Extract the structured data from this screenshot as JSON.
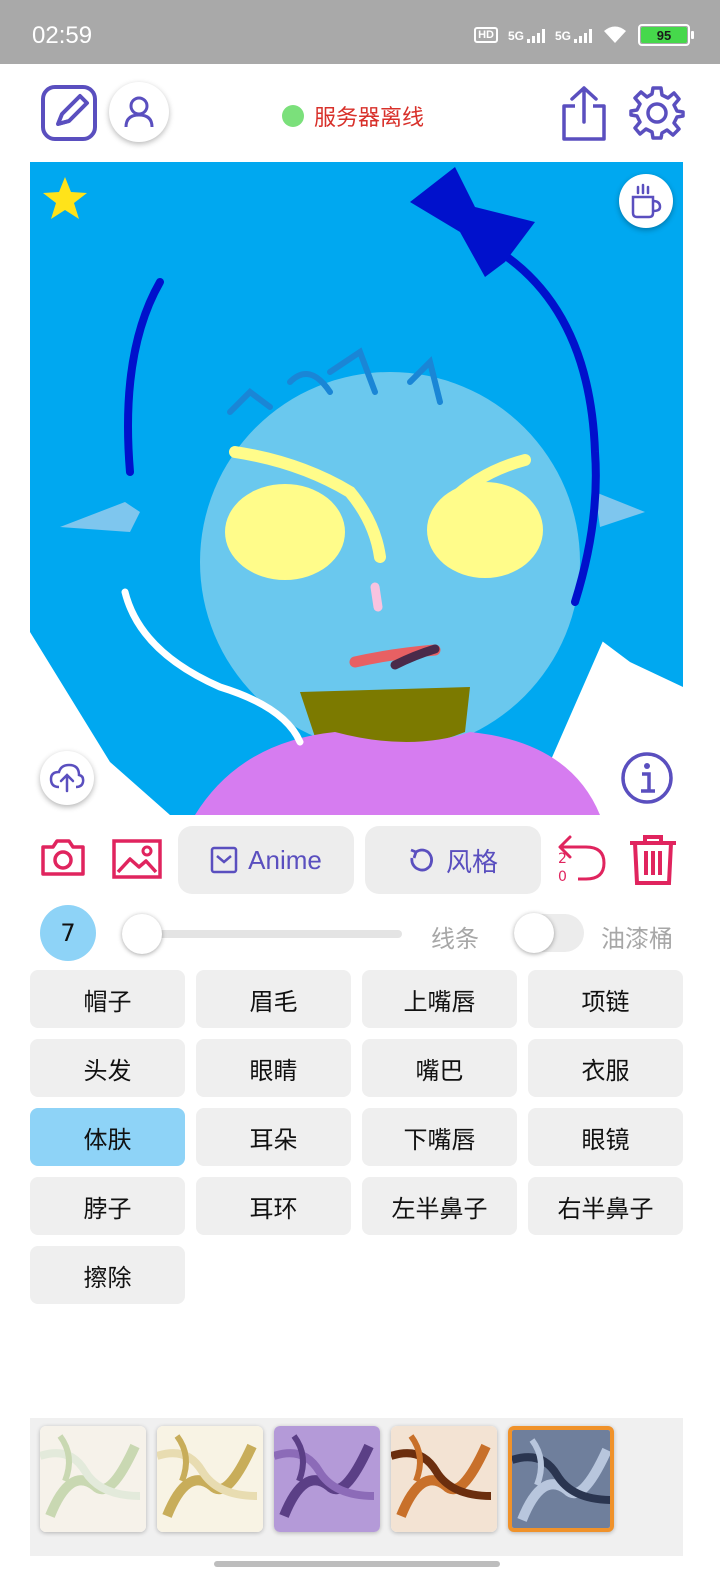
{
  "status_bar": {
    "time": "02:59",
    "battery": "95",
    "network_1": "5G",
    "network_2": "5G",
    "hd_label": "HD"
  },
  "header": {
    "server_status": "服务器离线",
    "server_dot_color": "#7be07b"
  },
  "icons": {
    "edit": "edit-square-icon",
    "profile": "person-icon",
    "share": "share-icon",
    "settings": "gear-icon",
    "favorite": "star-icon",
    "coffee": "coffee-cup-icon",
    "upload": "cloud-upload-icon",
    "info": "info-icon",
    "camera": "camera-icon",
    "gallery": "image-icon",
    "undo": "undo-icon",
    "trash": "trash-icon"
  },
  "actions": {
    "anime_label": "Anime",
    "style_label": "风格",
    "undo_numerator": "2",
    "undo_denominator": "0"
  },
  "brush": {
    "size": "7",
    "size_level": 0.0,
    "line_label": "线条",
    "bucket_label": "油漆桶",
    "bucket_on": false
  },
  "parts": [
    {
      "label": "帽子"
    },
    {
      "label": "眉毛"
    },
    {
      "label": "上嘴唇"
    },
    {
      "label": "项链"
    },
    {
      "label": "头发"
    },
    {
      "label": "眼睛"
    },
    {
      "label": "嘴巴"
    },
    {
      "label": "衣服"
    },
    {
      "label": "体肤",
      "selected": true
    },
    {
      "label": "耳朵"
    },
    {
      "label": "下嘴唇"
    },
    {
      "label": "眼镜"
    },
    {
      "label": "脖子"
    },
    {
      "label": "耳环"
    },
    {
      "label": "左半鼻子"
    },
    {
      "label": "右半鼻子"
    },
    {
      "label": "擦除"
    }
  ],
  "style_thumbnails": [
    {
      "name": "style-green",
      "selected": false
    },
    {
      "name": "style-gold",
      "selected": false
    },
    {
      "name": "style-purple",
      "selected": false
    },
    {
      "name": "style-orange",
      "selected": false
    },
    {
      "name": "style-blue",
      "selected": true
    }
  ],
  "colors": {
    "accent_purple": "#5a4fbf",
    "accent_red": "#e0245e",
    "selected_part": "#8ed3f7",
    "thumb_selected_border": "#f0922a"
  }
}
